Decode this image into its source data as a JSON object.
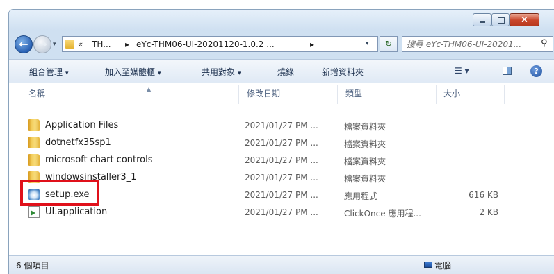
{
  "window": {
    "close_glyph": "×",
    "accent": "#c8452a"
  },
  "address": {
    "recent_dropdown": "▾",
    "breadcrumb": [
      "«",
      "TH...",
      "▸",
      "eYc-THM06-UI-20201120-1.0.2 ...",
      "▸"
    ],
    "dropdown": "▾",
    "refresh_icon": "refresh-icon"
  },
  "search": {
    "placeholder": "搜尋 eYc-THM06-UI-20201..."
  },
  "toolbar": {
    "organize": "組合管理",
    "add_to_library": "加入至媒體櫃",
    "share": "共用對象",
    "burn": "燒錄",
    "new_folder": "新增資料夾",
    "caret": "▾",
    "help": "?"
  },
  "columns": {
    "name": "名稱",
    "modified": "修改日期",
    "type": "類型",
    "size": "大小"
  },
  "files": [
    {
      "name": "Application Files",
      "date": "2021/01/27 PM ...",
      "type": "檔案資料夾",
      "size": "",
      "icon": "folder-icon"
    },
    {
      "name": "dotnetfx35sp1",
      "date": "2021/01/27 PM ...",
      "type": "檔案資料夾",
      "size": "",
      "icon": "folder-icon"
    },
    {
      "name": "microsoft chart controls",
      "date": "2021/01/27 PM ...",
      "type": "檔案資料夾",
      "size": "",
      "icon": "folder-icon"
    },
    {
      "name": "windowsinstaller3_1",
      "date": "2021/01/27 PM ...",
      "type": "檔案資料夾",
      "size": "",
      "icon": "folder-icon"
    },
    {
      "name": "setup.exe",
      "date": "2021/01/27 PM ...",
      "type": "應用程式",
      "size": "616 KB",
      "icon": "exe-icon"
    },
    {
      "name": "UI.application",
      "date": "2021/01/27 PM ...",
      "type": "ClickOnce 應用程...",
      "size": "2 KB",
      "icon": "clickonce-app-icon"
    }
  ],
  "status": {
    "item_count": "6 個項目",
    "location": "電腦"
  },
  "highlight": {
    "target": "setup.exe",
    "color": "#e0101a"
  }
}
